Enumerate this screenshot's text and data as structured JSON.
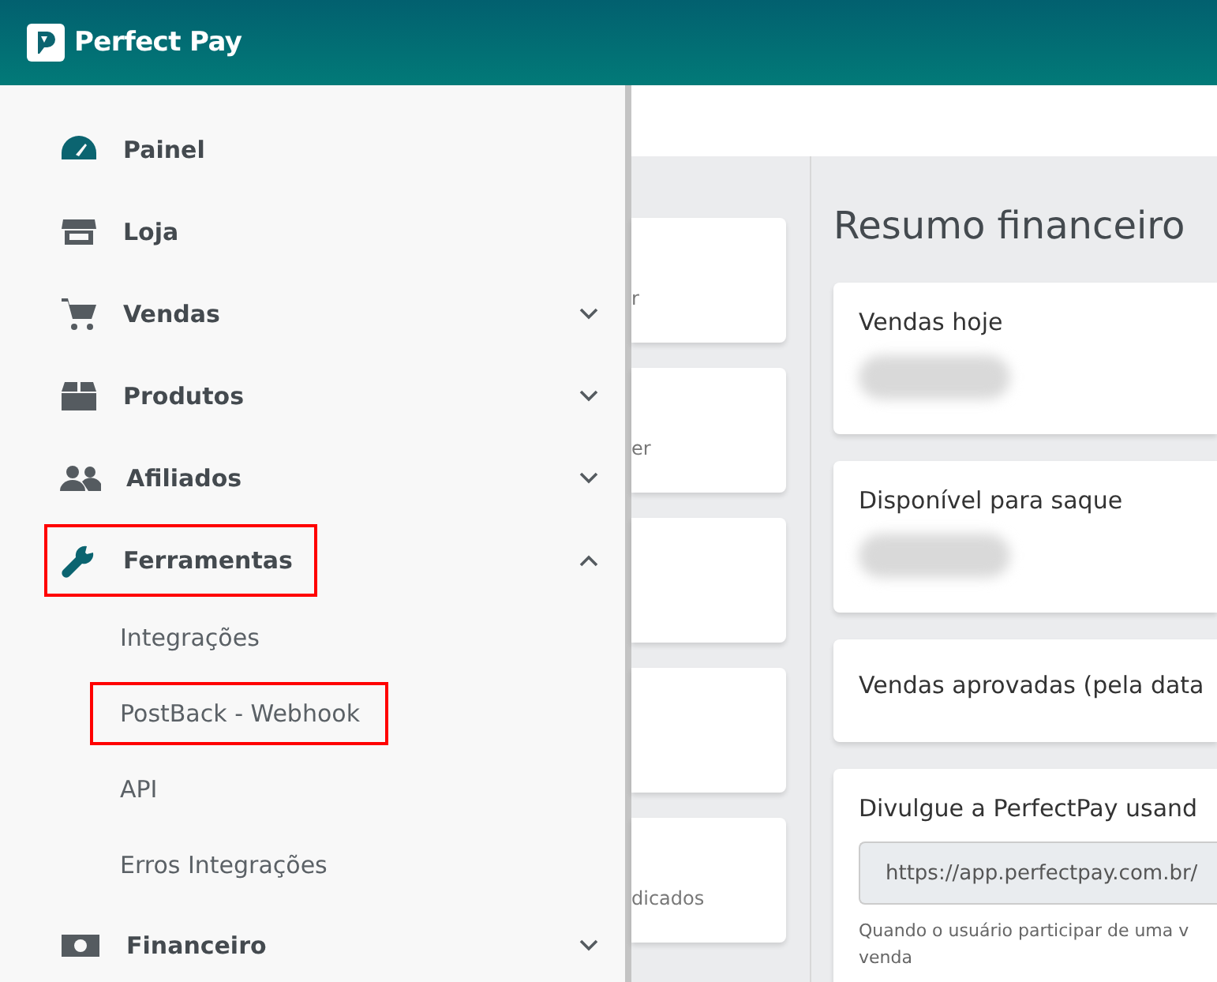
{
  "header": {
    "brand": "Perfect Pay"
  },
  "sidebar": {
    "items": [
      {
        "label": "Painel",
        "highlighted": false
      },
      {
        "label": "Loja",
        "highlighted": false
      },
      {
        "label": "Vendas",
        "expanded": false,
        "highlighted": false
      },
      {
        "label": "Produtos",
        "expanded": false,
        "highlighted": false
      },
      {
        "label": "Afiliados",
        "expanded": false,
        "highlighted": false
      },
      {
        "label": "Ferramentas",
        "expanded": true,
        "highlighted": true,
        "children": [
          {
            "label": "Integrações",
            "highlighted": false
          },
          {
            "label": "PostBack - Webhook",
            "highlighted": true
          },
          {
            "label": "API",
            "highlighted": false
          },
          {
            "label": "Erros Integrações",
            "highlighted": false
          }
        ]
      },
      {
        "label": "Financeiro",
        "expanded": false,
        "highlighted": false
      }
    ]
  },
  "left_cards": [
    {
      "kind": "text",
      "text": "r"
    },
    {
      "kind": "text",
      "text": "er"
    },
    {
      "kind": "blank"
    },
    {
      "kind": "blank"
    },
    {
      "kind": "text",
      "text": "dicados"
    }
  ],
  "summary": {
    "title": "Resumo financeiro",
    "cards": [
      {
        "kind": "value",
        "title": "Vendas hoje"
      },
      {
        "kind": "value",
        "title": "Disponível para saque"
      },
      {
        "kind": "plain",
        "title": "Vendas aprovadas (pela data"
      },
      {
        "kind": "share",
        "title": "Divulgue a PerfectPay usand",
        "link": "https://app.perfectpay.com.br/",
        "help": "Quando o usuário participar de uma v",
        "help_2": "venda"
      }
    ]
  }
}
